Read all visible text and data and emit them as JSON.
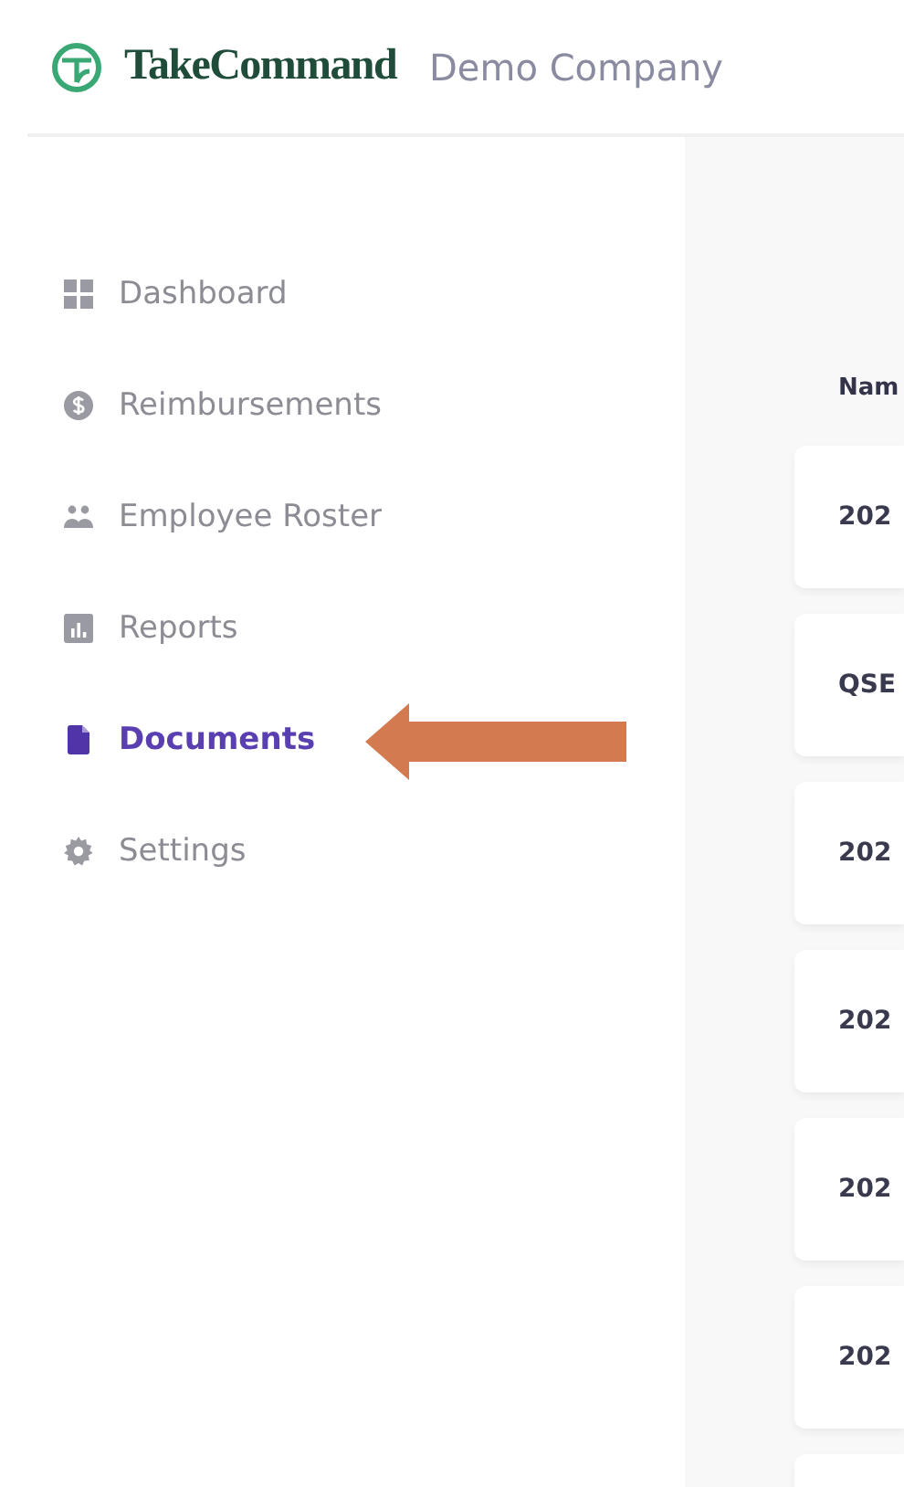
{
  "header": {
    "brand": "TakeCommand",
    "company": "Demo Company"
  },
  "sidebar": {
    "items": [
      {
        "label": "Dashboard",
        "selected": false
      },
      {
        "label": "Reimbursements",
        "selected": false
      },
      {
        "label": "Employee Roster",
        "selected": false
      },
      {
        "label": "Reports",
        "selected": false
      },
      {
        "label": "Documents",
        "selected": true
      },
      {
        "label": "Settings",
        "selected": false
      }
    ]
  },
  "table": {
    "columns": [
      "Nam"
    ],
    "rows": [
      "202",
      "QSE",
      "202",
      "202",
      "202",
      "202"
    ]
  }
}
